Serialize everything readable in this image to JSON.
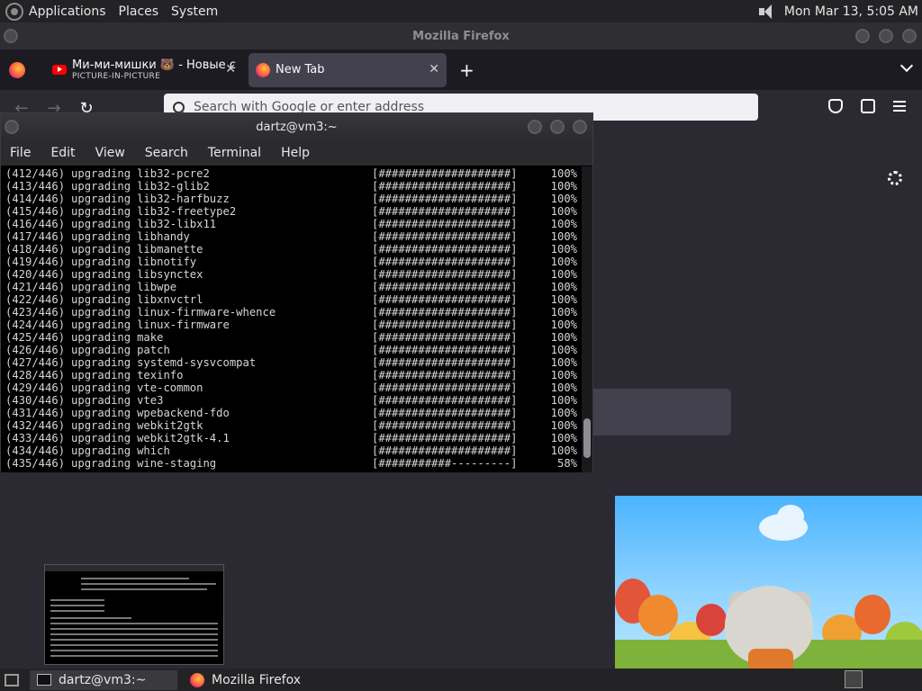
{
  "top_panel": {
    "menus": [
      "Applications",
      "Places",
      "System"
    ],
    "clock": "Mon Mar 13,  5:05 AM"
  },
  "firefox": {
    "window_title": "Mozilla Firefox",
    "tabs": [
      {
        "title": "Ми-ми-мишки 🐻 - Новые с",
        "subtitle": "PICTURE-IN-PICTURE"
      },
      {
        "title": "New Tab",
        "subtitle": ""
      }
    ],
    "new_tab_symbol": "+",
    "close_symbol": "✕",
    "urlbar_placeholder": "Search with Google or enter address"
  },
  "terminal": {
    "window_title": "dartz@vm3:~",
    "menus": [
      "File",
      "Edit",
      "View",
      "Search",
      "Terminal",
      "Help"
    ],
    "lines": [
      {
        "num": "(412/446)",
        "pkg": "lib32-pcre2",
        "bar": "[####################]",
        "pct": "100%"
      },
      {
        "num": "(413/446)",
        "pkg": "lib32-glib2",
        "bar": "[####################]",
        "pct": "100%"
      },
      {
        "num": "(414/446)",
        "pkg": "lib32-harfbuzz",
        "bar": "[####################]",
        "pct": "100%"
      },
      {
        "num": "(415/446)",
        "pkg": "lib32-freetype2",
        "bar": "[####################]",
        "pct": "100%"
      },
      {
        "num": "(416/446)",
        "pkg": "lib32-libx11",
        "bar": "[####################]",
        "pct": "100%"
      },
      {
        "num": "(417/446)",
        "pkg": "libhandy",
        "bar": "[####################]",
        "pct": "100%"
      },
      {
        "num": "(418/446)",
        "pkg": "libmanette",
        "bar": "[####################]",
        "pct": "100%"
      },
      {
        "num": "(419/446)",
        "pkg": "libnotify",
        "bar": "[####################]",
        "pct": "100%"
      },
      {
        "num": "(420/446)",
        "pkg": "libsynctex",
        "bar": "[####################]",
        "pct": "100%"
      },
      {
        "num": "(421/446)",
        "pkg": "libwpe",
        "bar": "[####################]",
        "pct": "100%"
      },
      {
        "num": "(422/446)",
        "pkg": "libxnvctrl",
        "bar": "[####################]",
        "pct": "100%"
      },
      {
        "num": "(423/446)",
        "pkg": "linux-firmware-whence",
        "bar": "[####################]",
        "pct": "100%"
      },
      {
        "num": "(424/446)",
        "pkg": "linux-firmware",
        "bar": "[####################]",
        "pct": "100%"
      },
      {
        "num": "(425/446)",
        "pkg": "make",
        "bar": "[####################]",
        "pct": "100%"
      },
      {
        "num": "(426/446)",
        "pkg": "patch",
        "bar": "[####################]",
        "pct": "100%"
      },
      {
        "num": "(427/446)",
        "pkg": "systemd-sysvcompat",
        "bar": "[####################]",
        "pct": "100%"
      },
      {
        "num": "(428/446)",
        "pkg": "texinfo",
        "bar": "[####################]",
        "pct": "100%"
      },
      {
        "num": "(429/446)",
        "pkg": "vte-common",
        "bar": "[####################]",
        "pct": "100%"
      },
      {
        "num": "(430/446)",
        "pkg": "vte3",
        "bar": "[####################]",
        "pct": "100%"
      },
      {
        "num": "(431/446)",
        "pkg": "wpebackend-fdo",
        "bar": "[####################]",
        "pct": "100%"
      },
      {
        "num": "(432/446)",
        "pkg": "webkit2gtk",
        "bar": "[####################]",
        "pct": "100%"
      },
      {
        "num": "(433/446)",
        "pkg": "webkit2gtk-4.1",
        "bar": "[####################]",
        "pct": "100%"
      },
      {
        "num": "(434/446)",
        "pkg": "which",
        "bar": "[####################]",
        "pct": "100%"
      },
      {
        "num": "(435/446)",
        "pkg": "wine-staging",
        "bar": "[###########---------]",
        "pct": "58%"
      }
    ],
    "verb": "upgrading"
  },
  "taskbar": {
    "items": [
      "dartz@vm3:~",
      "Mozilla Firefox"
    ]
  },
  "colors": {
    "panel_bg": "#232326",
    "firefox_bg": "#2b2a33",
    "terminal_bg": "#000000",
    "terminal_fg": "#d6d6d6"
  }
}
